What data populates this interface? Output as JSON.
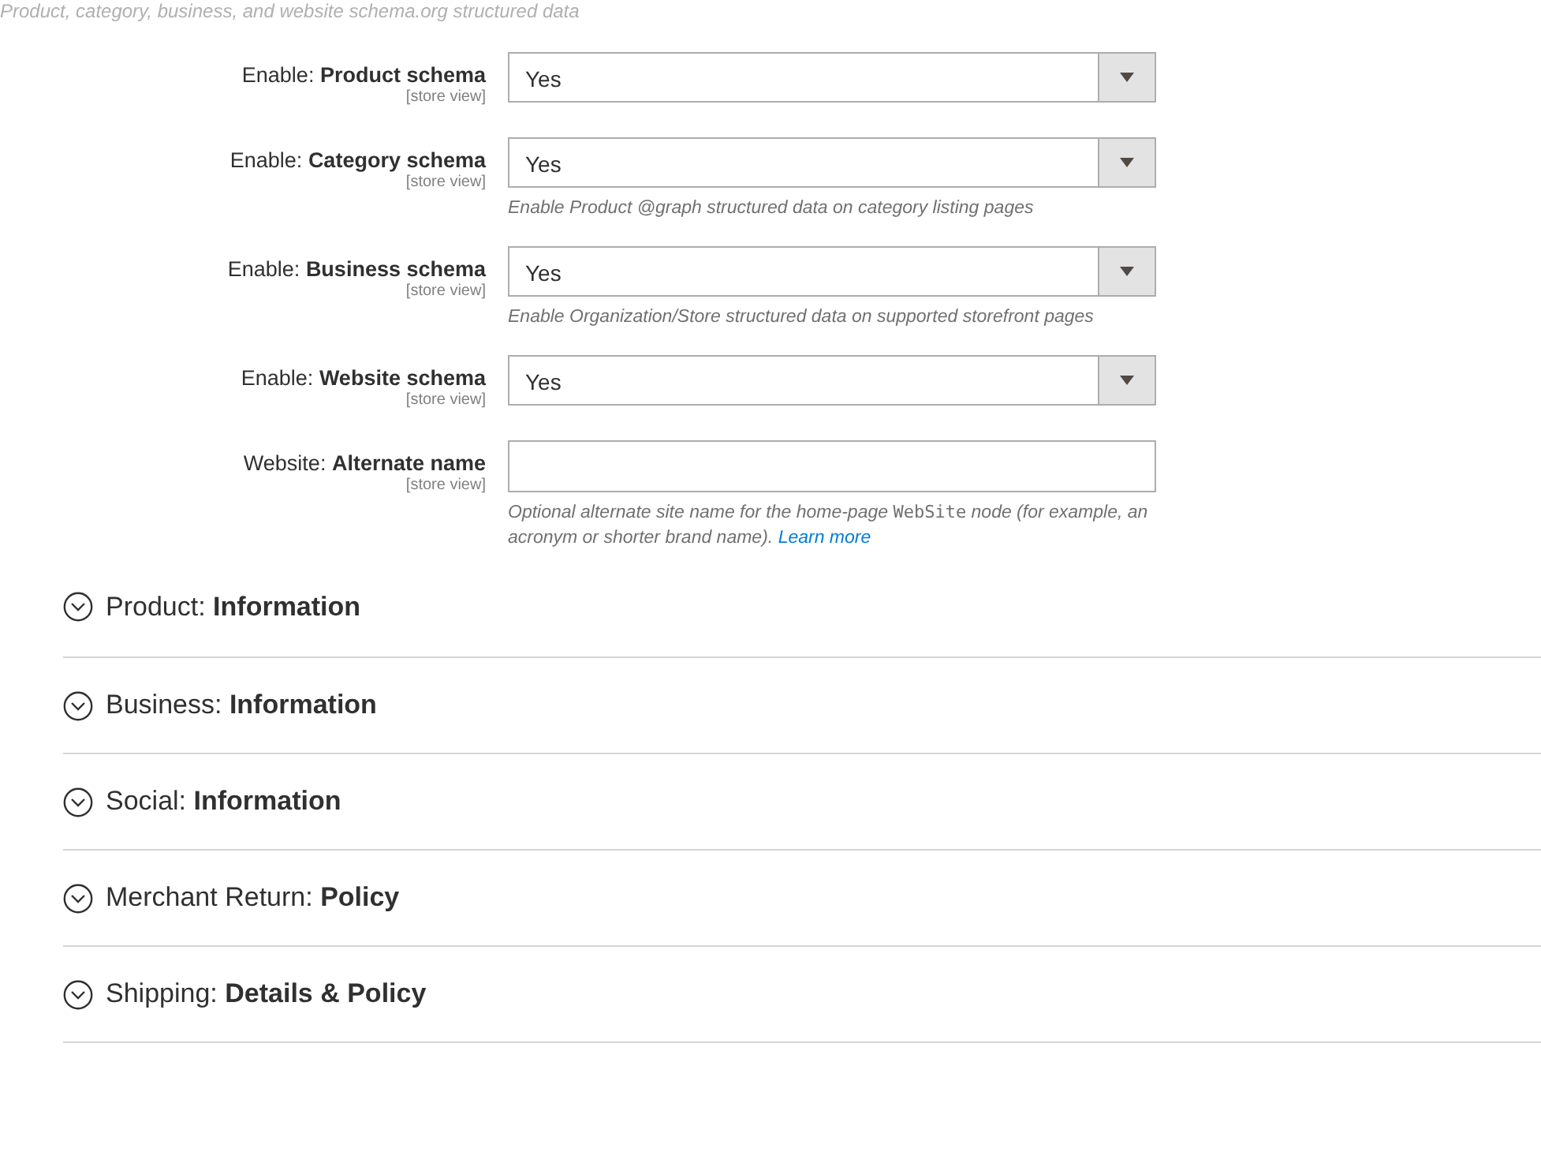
{
  "intro": "Product, category, business, and website schema.org structured data",
  "fields": [
    {
      "kind": "select",
      "label": "Enable: **Product schema**",
      "scope": "[store view]",
      "value": "Yes"
    },
    {
      "kind": "select",
      "label": "Enable: **Category schema**",
      "scope": "[store view]",
      "value": "Yes",
      "note": {
        "text": "Enable Product @graph structured data on category listing pages"
      }
    },
    {
      "kind": "select",
      "label": "Enable: **Business schema**",
      "scope": "[store view]",
      "value": "Yes",
      "note": {
        "text": "Enable Organization/Store structured data on supported storefront pages"
      }
    },
    {
      "kind": "select",
      "label": "Enable: **Website schema**",
      "scope": "[store view]",
      "value": "Yes"
    },
    {
      "kind": "text",
      "label": "Website: **Alternate name**",
      "scope": "[store view]",
      "note": {
        "text": "Optional alternate site name for the home-page",
        "code": "WebSite",
        "text_after": "node (for example, an acronym or shorter brand name).",
        "link": "Learn more"
      }
    }
  ],
  "sections": [
    {
      "label": "Product: **Information**",
      "expanded": false
    },
    {
      "label": "Business: **Information**",
      "expanded": false
    },
    {
      "label": "Social: **Information**",
      "expanded": false
    },
    {
      "label": "Merchant Return: **Policy**",
      "expanded": false
    },
    {
      "label": "Shipping: **Details & Policy**",
      "expanded": false
    }
  ]
}
